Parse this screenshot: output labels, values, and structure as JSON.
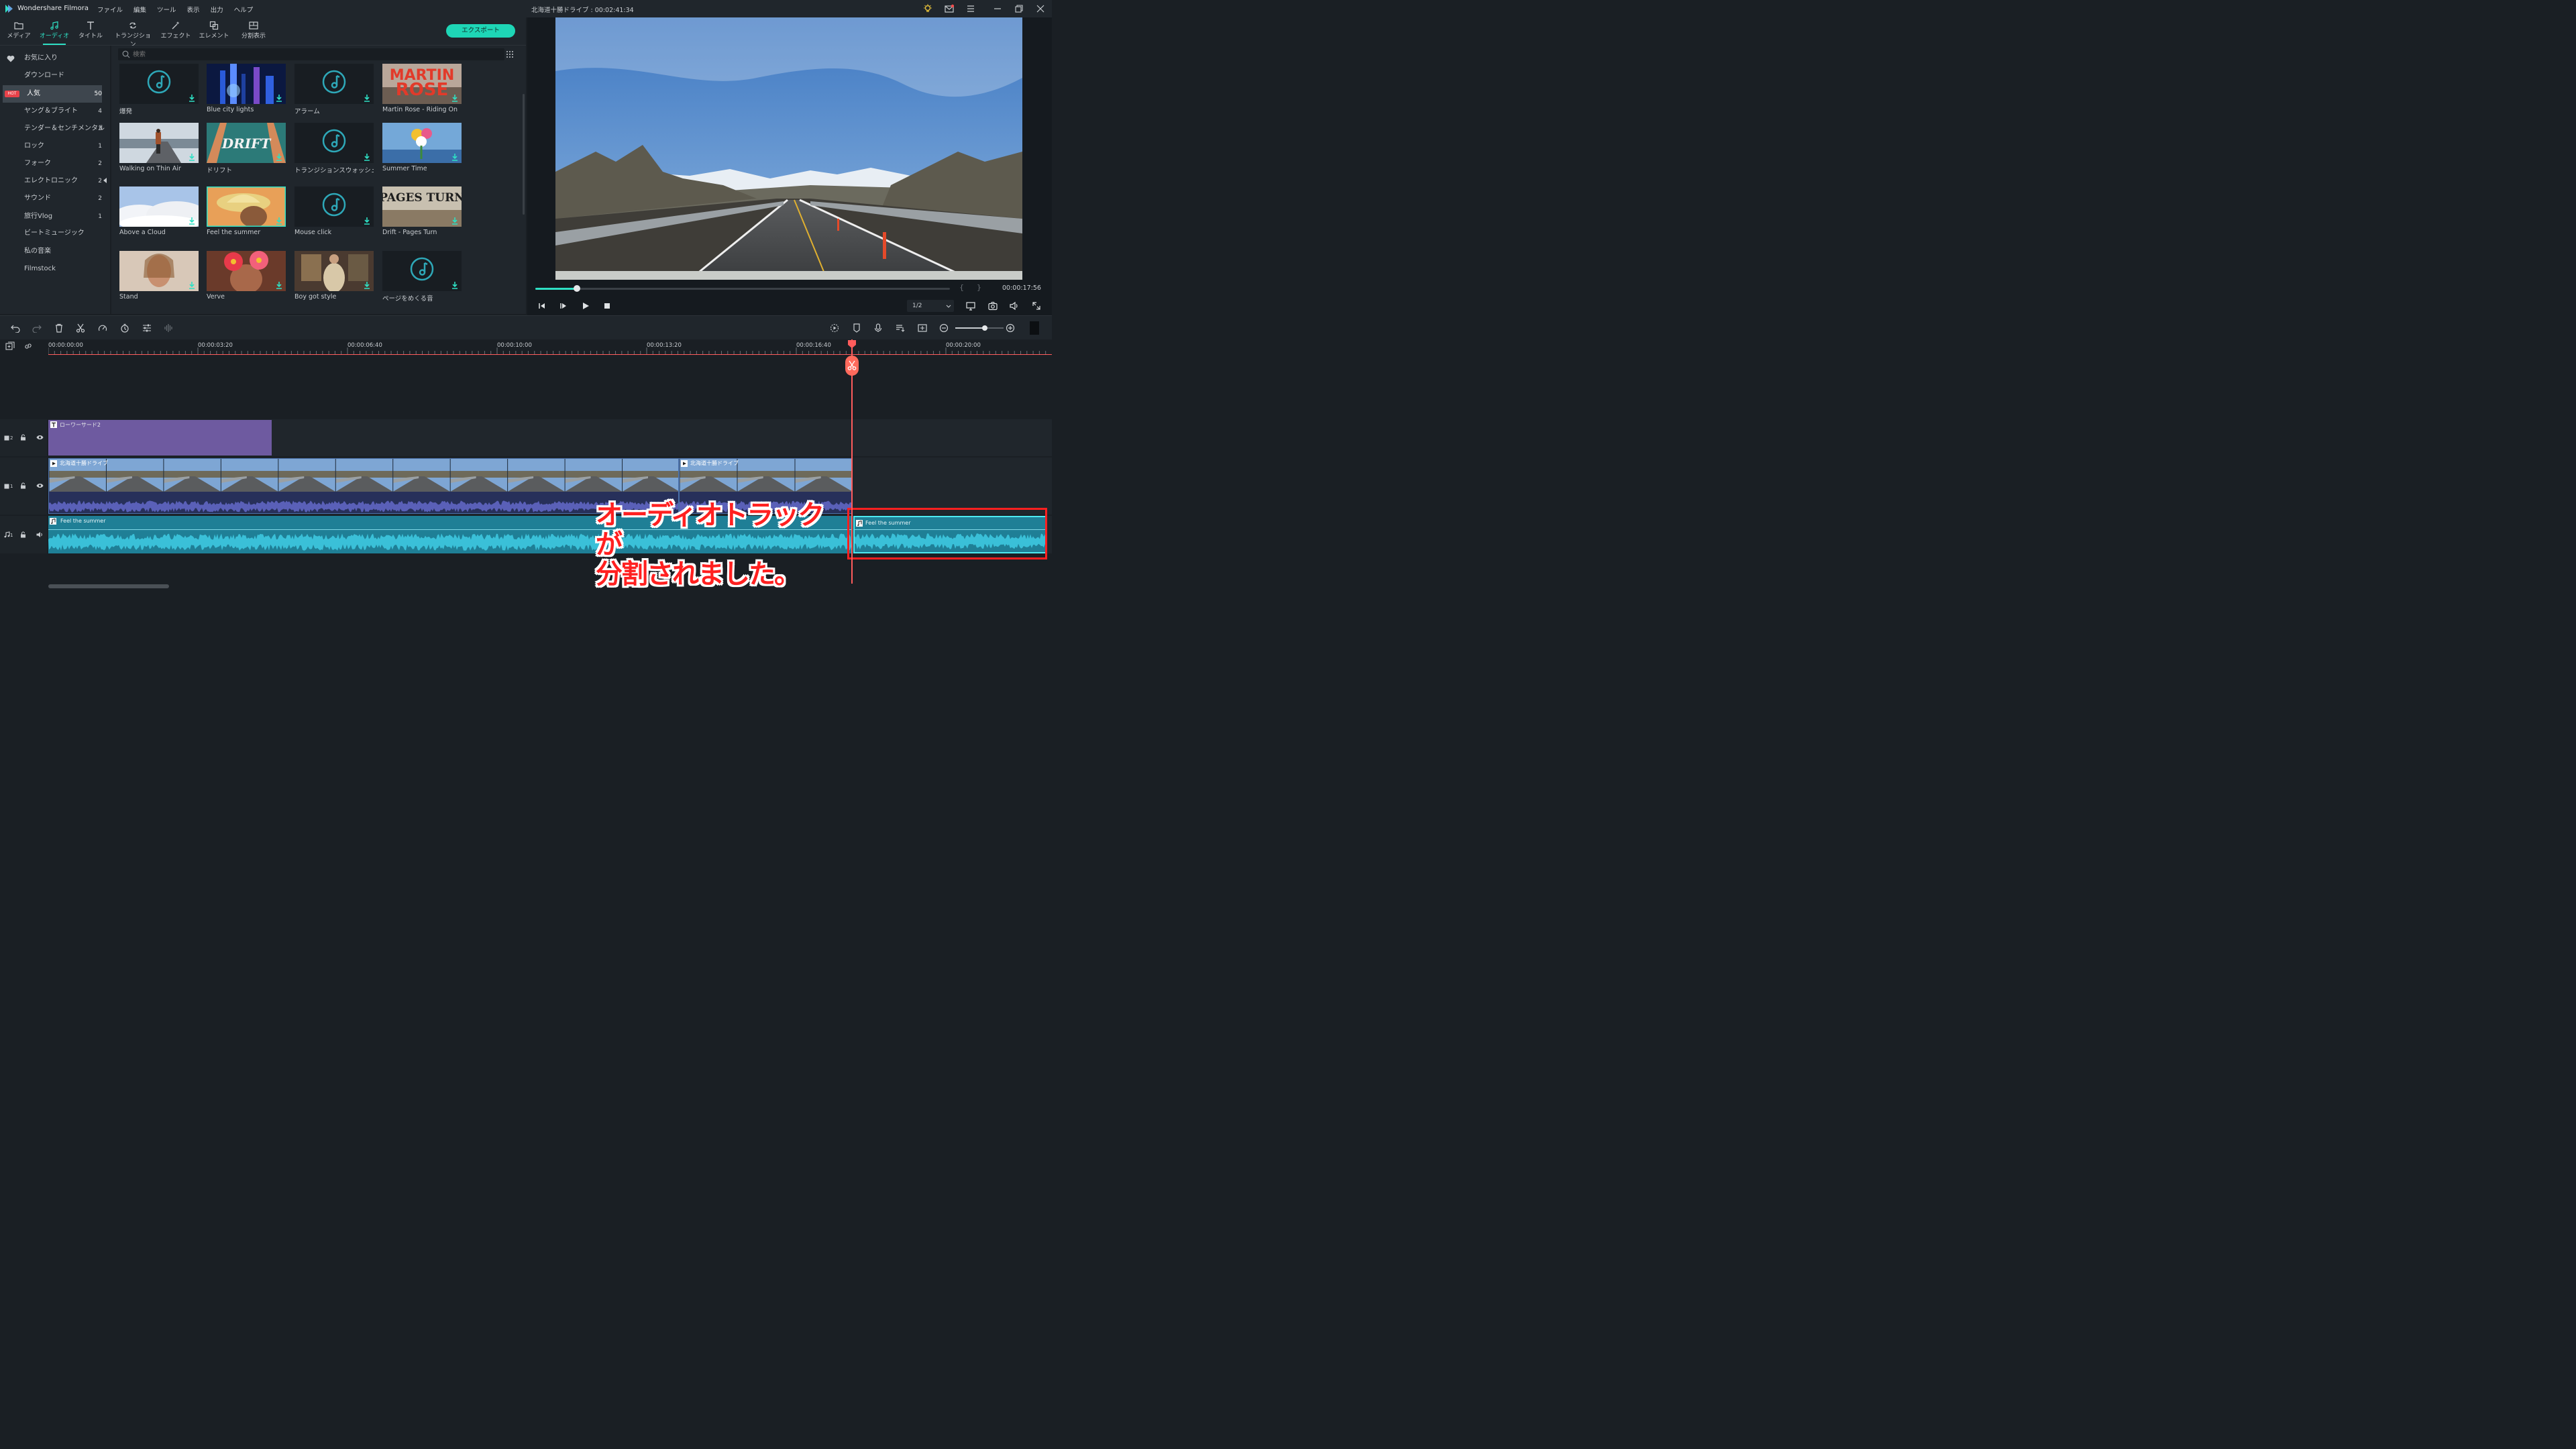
{
  "app": {
    "name": "Wondershare Filmora",
    "menu": [
      "ファイル",
      "編集",
      "ツール",
      "表示",
      "出力",
      "ヘルプ"
    ],
    "project_title": "北海道十勝ドライブ : 00:02:41:34"
  },
  "tabs": [
    {
      "label": "メディア"
    },
    {
      "label": "オーディオ"
    },
    {
      "label": "タイトル"
    },
    {
      "label": "トランジション"
    },
    {
      "label": "エフェクト"
    },
    {
      "label": "エレメント"
    },
    {
      "label": "分割表示"
    }
  ],
  "export_label": "エクスポート",
  "sidebar": [
    {
      "label": "お気に入り",
      "count": ""
    },
    {
      "label": "ダウンロード",
      "count": ""
    },
    {
      "label": "人気",
      "count": "50",
      "hot": "HOT"
    },
    {
      "label": "ヤング＆ブライト",
      "count": "4"
    },
    {
      "label": "テンダー＆センチメンタル",
      "count": "3"
    },
    {
      "label": "ロック",
      "count": "1"
    },
    {
      "label": "フォーク",
      "count": "2"
    },
    {
      "label": "エレクトロニック",
      "count": "2"
    },
    {
      "label": "サウンド",
      "count": "2"
    },
    {
      "label": "旅行Vlog",
      "count": "1"
    },
    {
      "label": "ビートミュージック",
      "count": ""
    },
    {
      "label": "私の音楽",
      "count": ""
    },
    {
      "label": "Filmstock",
      "count": ""
    }
  ],
  "search_placeholder": "検索",
  "library": [
    {
      "label": "爆発",
      "thumb": "note"
    },
    {
      "label": "Blue city lights",
      "thumb": "city"
    },
    {
      "label": "アラーム",
      "thumb": "note"
    },
    {
      "label": "Martin Rose - Riding On",
      "thumb": "martin",
      "text": "MARTIN ROSE"
    },
    {
      "label": "Walking on Thin Air",
      "thumb": "walk"
    },
    {
      "label": "ドリフト",
      "thumb": "drift",
      "text": "DRIFT"
    },
    {
      "label": "トランジションスウォッシュ",
      "thumb": "note"
    },
    {
      "label": "Summer Time",
      "thumb": "summer"
    },
    {
      "label": "Above a Cloud",
      "thumb": "cloud"
    },
    {
      "label": "Feel the summer",
      "thumb": "feel"
    },
    {
      "label": "Mouse click",
      "thumb": "note"
    },
    {
      "label": "Drift - Pages Turn",
      "thumb": "pages",
      "text": "PAGES TURN"
    },
    {
      "label": "Stand",
      "thumb": "stand"
    },
    {
      "label": "Verve",
      "thumb": "verve"
    },
    {
      "label": "Boy got style",
      "thumb": "boy"
    },
    {
      "label": "ページをめくる音",
      "thumb": "note"
    }
  ],
  "player": {
    "time": "00:00:17:56",
    "quality": "1/2",
    "progress": 0.1
  },
  "timeline": {
    "ruler": [
      "00:00:00:00",
      "00:00:03:20",
      "00:00:06:40",
      "00:00:10:00",
      "00:00:13:20",
      "00:00:16:40",
      "00:00:20:00"
    ],
    "title_clip": "ローワーサード2",
    "video_clip_1": "北海道十勝ドライブ",
    "video_clip_2": "北海道十勝ドライブ",
    "audio_clip_1": "Feel the summer",
    "audio_clip_2": "Feel the summer",
    "track_labels": [
      "2",
      "1",
      "1"
    ]
  },
  "annotation": {
    "line1": "オーディオトラックが",
    "line2": "分割されました。",
    "color": "#ff2020"
  },
  "colors": {
    "accent": "#2ee0c4",
    "playhead": "#ff5c5c",
    "title_clip": "#6e5aa0",
    "audio_clip": "#1f7f96"
  }
}
